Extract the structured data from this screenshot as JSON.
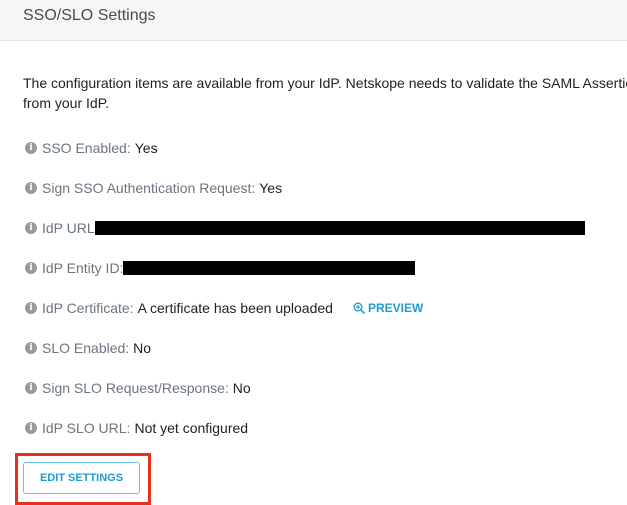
{
  "header": {
    "title": "SSO/SLO Settings"
  },
  "intro": {
    "text": "The configuration items are available from your IdP. Netskope needs to validate the SAML Assertion from your IdP."
  },
  "settings": [
    {
      "label": "SSO Enabled:",
      "value": "Yes",
      "icon": "info-icon"
    },
    {
      "label": "Sign SSO Authentication Request:",
      "value": "Yes",
      "icon": "info-icon"
    },
    {
      "label": "IdP URL",
      "value": "[redacted]",
      "icon": "info-icon"
    },
    {
      "label": "IdP Entity ID:",
      "value": "[redacted]",
      "icon": "info-icon"
    },
    {
      "label": "IdP Certificate:",
      "value": "A certificate has been uploaded",
      "icon": "info-icon",
      "action": {
        "label": "PREVIEW",
        "icon": "zoom-in-icon"
      }
    },
    {
      "label": "SLO Enabled:",
      "value": "No",
      "icon": "info-icon"
    },
    {
      "label": "Sign SLO Request/Response:",
      "value": "No",
      "icon": "info-icon"
    },
    {
      "label": "IdP SLO URL:",
      "value": "Not yet configured",
      "icon": "info-icon"
    }
  ],
  "actions": {
    "edit_label": "EDIT SETTINGS"
  },
  "colors": {
    "accent": "#1f9bd0",
    "label": "#6b7580",
    "highlight": "#e8301c",
    "header_bg": "#f6f6f6"
  }
}
